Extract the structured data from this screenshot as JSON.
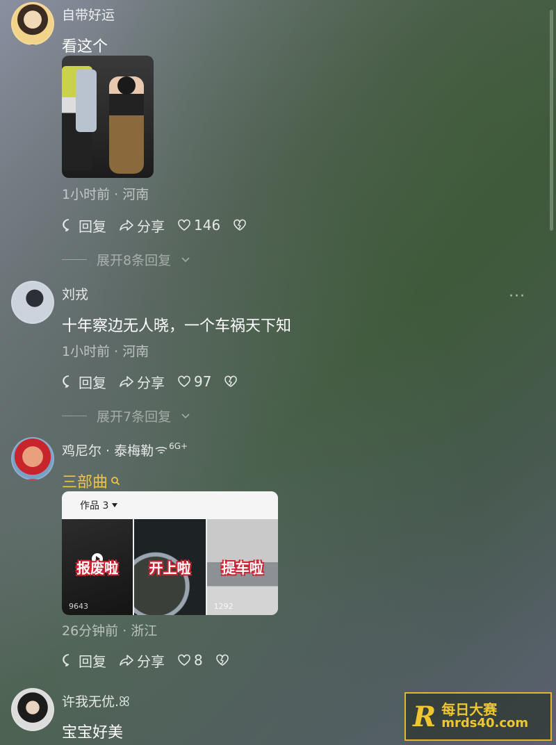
{
  "comments": [
    {
      "name": "自带好运",
      "text": "看这个",
      "meta": "1小时前 · 河南",
      "reply": "回复",
      "share": "分享",
      "likes": "146",
      "expand": "展开8条回复"
    },
    {
      "name": "刘戎",
      "text": "十年察边无人晓，一个车祸天下知",
      "meta": "1小时前 · 河南",
      "reply": "回复",
      "share": "分享",
      "likes": "97",
      "expand": "展开7条回复",
      "more": "···"
    },
    {
      "name": "鸡尼尔 · 泰梅勒",
      "badge": "6G+",
      "link_text": "三部曲",
      "works_label": "作品 3",
      "thumbs": [
        {
          "label": "报废啦",
          "count": "9643"
        },
        {
          "label": "开上啦",
          "count": ""
        },
        {
          "label": "提车啦",
          "count": "1292"
        }
      ],
      "meta": "26分钟前 · 浙江",
      "reply": "回复",
      "share": "分享",
      "likes": "8"
    },
    {
      "name": "许我无优.ꕤ",
      "text": "宝宝好美"
    }
  ],
  "watermark": {
    "logo": "R",
    "title": "每日大赛",
    "domain": "mrds40.com"
  },
  "colors": {
    "accent": "#f2c542",
    "watermark": "#e4b52d"
  }
}
